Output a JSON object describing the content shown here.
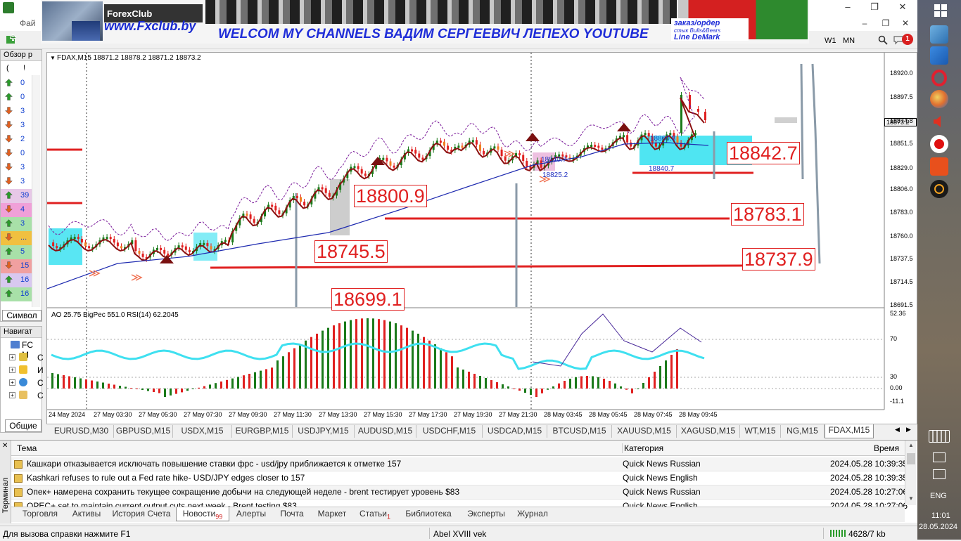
{
  "window": {
    "menu_first": "Фай",
    "controls": [
      "–",
      "❐",
      "✕"
    ],
    "child_controls": [
      "–",
      "❐",
      "✕"
    ]
  },
  "banner": {
    "logo": "ForexClub",
    "site": "www.Fxclub.by",
    "headline": "WELCOM MY CHANNELS ВАДИМ СЕРГЕЕВИЧ ЛЕПЕХО YOUTUBE",
    "side_line1": "заказ/ордер",
    "side_line2": "стык Bulls&Bears",
    "side_line3": "Line DeMark"
  },
  "toolbar": {
    "timeframes": [
      "W1",
      "MN"
    ],
    "notification_count": "1"
  },
  "market_watch": {
    "title": "Обзор р",
    "col_headers": [
      "(",
      "!"
    ],
    "rows": [
      {
        "dir": "up",
        "value": "0",
        "bg": ""
      },
      {
        "dir": "up",
        "value": "0",
        "bg": ""
      },
      {
        "dir": "down",
        "value": "3",
        "bg": ""
      },
      {
        "dir": "down",
        "value": "3",
        "bg": ""
      },
      {
        "dir": "down",
        "value": "2",
        "bg": ""
      },
      {
        "dir": "down",
        "value": "0",
        "bg": ""
      },
      {
        "dir": "down",
        "value": "3",
        "bg": ""
      },
      {
        "dir": "down",
        "value": "3",
        "bg": ""
      },
      {
        "dir": "up",
        "value": "39",
        "bg": "#e7c8e7"
      },
      {
        "dir": "down",
        "value": "4",
        "bg": "#f0a0d8"
      },
      {
        "dir": "up",
        "value": "3",
        "bg": "#a8e0a8"
      },
      {
        "dir": "down",
        "value": "...",
        "bg": "#f0c040"
      },
      {
        "dir": "up",
        "value": "5",
        "bg": "#a8e0a8"
      },
      {
        "dir": "down",
        "value": "15",
        "bg": "#f0a0a0"
      },
      {
        "dir": "up",
        "value": "16",
        "bg": "#d8c8f0"
      },
      {
        "dir": "up",
        "value": "16",
        "bg": "#a8e0a8"
      }
    ],
    "tab_label": "Символ"
  },
  "navigator": {
    "title": "Навигат",
    "root": "FC M",
    "items": [
      "C",
      "И",
      "С",
      "С"
    ],
    "tab_label": "Общие"
  },
  "chart": {
    "info": "FDAX,M15  18871.2 18878.2 18871.2 18873.2",
    "current_price": "18873.2",
    "price_axis": [
      "18920.0",
      "18897.5",
      "18874.8",
      "18851.5",
      "18829.0",
      "18806.0",
      "18783.0",
      "18760.0",
      "18737.5",
      "18714.5",
      "18691.5"
    ],
    "levels": [
      "18842.7",
      "18800.9",
      "18783.1",
      "18745.5",
      "18737.9",
      "18699.1"
    ],
    "small_labels": [
      "18860.8",
      "18840.7",
      "18825.2",
      "18840.7"
    ],
    "sub_info": "AO 25.75  BigPec 551.0  RSI(14) 62.2045",
    "sub_axis": [
      "52.36",
      "70",
      "30",
      "0.00",
      "-11.1"
    ],
    "time_axis": [
      "24 May 2024",
      "27 May 03:30",
      "27 May 05:30",
      "27 May 07:30",
      "27 May 09:30",
      "27 May 11:30",
      "27 May 13:30",
      "27 May 15:30",
      "27 May 17:30",
      "27 May 19:30",
      "27 May 21:30",
      "28 May 03:45",
      "28 May 05:45",
      "28 May 07:45",
      "28 May 09:45"
    ]
  },
  "chart_tabs": [
    "EURUSD,M30",
    "GBPUSD,M15",
    "USDX,M15",
    "EURGBP,M15",
    "USDJPY,M15",
    "AUDUSD,M15",
    "USDCHF,M15",
    "USDCAD,M15",
    "BTCUSD,M15",
    "XAUUSD,M15",
    "XAGUSD,M15",
    "WT,M15",
    "NG,M15",
    "FDAX,M15"
  ],
  "terminal": {
    "side_label": "Терминал",
    "headers": {
      "topic": "Тема",
      "category": "Категория",
      "time": "Время"
    },
    "news": [
      {
        "topic": "Кашкари отказывается исключать повышение ставки фрс - usd/jpy приближается к отметке 157",
        "category": "Quick News Russian",
        "time": "2024.05.28 10:39:35"
      },
      {
        "topic": "Kashkari refuses to rule out a Fed rate hike- USD/JPY edges closer to 157",
        "category": "Quick News English",
        "time": "2024.05.28 10:39:35"
      },
      {
        "topic": "Опек+ намерена сохранить текущее сокращение добычи на следующей неделе - brent тестирует уровень $83",
        "category": "Quick News Russian",
        "time": "2024.05.28 10:27:06"
      },
      {
        "topic": "OPEC+ set to maintain current output cuts next week - Brent testing $83",
        "category": "Quick News English",
        "time": "2024.05.28 10:27:06"
      }
    ],
    "tabs": [
      {
        "label": "Торговля",
        "badge": ""
      },
      {
        "label": "Активы",
        "badge": ""
      },
      {
        "label": "История Счета",
        "badge": ""
      },
      {
        "label": "Новости",
        "badge": "99"
      },
      {
        "label": "Алерты",
        "badge": ""
      },
      {
        "label": "Почта",
        "badge": ""
      },
      {
        "label": "Маркет",
        "badge": ""
      },
      {
        "label": "Статьи",
        "badge": "1"
      },
      {
        "label": "Библиотека",
        "badge": ""
      },
      {
        "label": "Эксперты",
        "badge": ""
      },
      {
        "label": "Журнал",
        "badge": ""
      }
    ]
  },
  "status": {
    "help": "Для вызова справки нажмите F1",
    "profile": "Abel XVIII vek",
    "traffic": "4628/7 kb"
  },
  "taskbar": {
    "lang": "ENG",
    "time": "11:01",
    "date": "28.05.2024"
  },
  "colors": {
    "level_red": "#e02020",
    "bull_green": "#1a7a1a",
    "bear_red": "#e02020",
    "ma_blue": "#1f2bb0",
    "rsi_cyan": "#3fe0f0",
    "zone_cyan": "#30e0f0"
  }
}
